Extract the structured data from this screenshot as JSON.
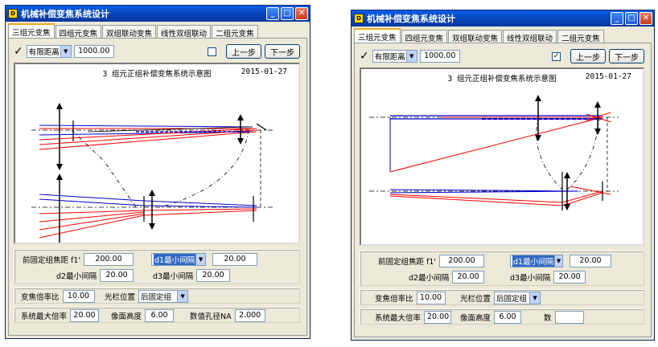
{
  "windows": [
    {
      "title": "机械补偿变焦系统设计",
      "tabs": [
        "三组元变焦",
        "四组元变焦",
        "双组联动变焦",
        "线性双组联动",
        "二组元变焦"
      ],
      "toolbar": {
        "check_glyph": "✓",
        "mode_select": "有限距离",
        "distance_value": "1000.00",
        "checkbox_checked": false,
        "checkbox_glyph": "",
        "prev_label": "上一步",
        "next_label": "下一步"
      },
      "diagram": {
        "title": "3 组元正组补偿变焦系统示意图",
        "date": "2015-01-27"
      },
      "form": {
        "front_focal_label": "前固定组焦距 f1'",
        "front_focal_value": "200.00",
        "interval_select": "d1最小间隔",
        "interval_value": "20.00",
        "d2_label": "d2最小间隔",
        "d2_value": "20.00",
        "d3_label": "d3最小间隔",
        "d3_value": "20.00",
        "zoom_ratio_label": "变焦倍率比",
        "zoom_ratio_value": "10.00",
        "stop_label": "光栏位置",
        "stop_select": "后固定组",
        "max_mag_label": "系统最大倍率",
        "max_mag_value": "20.00",
        "image_height_label": "像面高度",
        "image_height_value": "6.00",
        "na_label": "数值孔径NA",
        "na_value": "2.000"
      }
    },
    {
      "title": "机械补偿变焦系统设计",
      "tabs": [
        "三组元变焦",
        "四组元变焦",
        "双组联动变焦",
        "线性双组联动",
        "二组元变焦"
      ],
      "toolbar": {
        "check_glyph": "✓",
        "mode_select": "有限距离",
        "distance_value": "1000.00",
        "checkbox_checked": true,
        "checkbox_glyph": "✓",
        "prev_label": "上一步",
        "next_label": "下一步"
      },
      "diagram": {
        "title": "3 组元正组补偿变焦系统示意图",
        "date": "2015-01-27"
      },
      "form": {
        "front_focal_label": "前固定组焦距 f1'",
        "front_focal_value": "200.00",
        "interval_select": "d1最小间隔",
        "interval_value": "20.00",
        "d2_label": "d2最小间隔",
        "d2_value": "20.00",
        "d3_label": "d3最小间隔",
        "d3_value": "20.00",
        "zoom_ratio_label": "变焦倍率比",
        "zoom_ratio_value": "10.00",
        "stop_label": "光栏位置",
        "stop_select": "后固定组",
        "max_mag_label": "系统最大倍率",
        "max_mag_value": "20.00",
        "image_height_label": "像面高度",
        "image_height_value": "6.00",
        "na_label": "数",
        "na_value": ""
      }
    }
  ],
  "colors": {
    "title_bar": "#0842b6",
    "ray_red": "#ff0000",
    "ray_blue": "#0000cc",
    "highlight": "#316ac5"
  }
}
